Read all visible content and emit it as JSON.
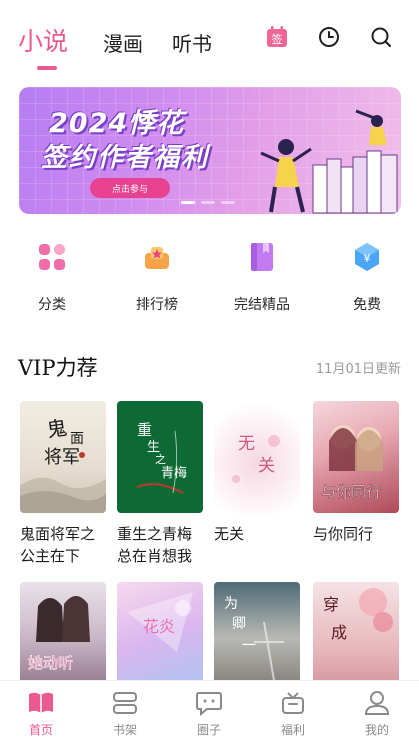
{
  "top_tabs": [
    {
      "label": "小说",
      "active": true
    },
    {
      "label": "漫画",
      "active": false
    },
    {
      "label": "听书",
      "active": false
    }
  ],
  "top_icons": {
    "sign_badge": "签",
    "clock": "clock-icon",
    "search": "search-icon"
  },
  "banner": {
    "title_line1": "2024悸花",
    "title_line2": "签约作者福利",
    "button_label": "点击参与",
    "slide_count": 3,
    "active_slide": 1
  },
  "categories": [
    {
      "label": "分类",
      "icon": "grid-icon",
      "color": "#f06ea8"
    },
    {
      "label": "排行榜",
      "icon": "trophy-icon",
      "color": "#f7a34a"
    },
    {
      "label": "完结精品",
      "icon": "book-icon",
      "color": "#c27af0"
    },
    {
      "label": "免费",
      "icon": "yen-hexagon-icon",
      "color": "#4aa6f5"
    }
  ],
  "vip": {
    "title": "VIP力荐",
    "update_text": "11月01日更新",
    "books": [
      {
        "title": "鬼面将军之公主在下",
        "cover_text": "鬼面将军"
      },
      {
        "title": "重生之青梅总在肖想我",
        "cover_text": "重生之青梅"
      },
      {
        "title": "无关",
        "cover_text": "无关"
      },
      {
        "title": "与你同行",
        "cover_text": "与你同行"
      },
      {
        "title": "",
        "cover_text": "她动听"
      },
      {
        "title": "",
        "cover_text": "花炎"
      },
      {
        "title": "",
        "cover_text": "为卿"
      },
      {
        "title": "",
        "cover_text": "穿成"
      }
    ]
  },
  "bottom_nav": [
    {
      "label": "首页",
      "icon": "home-book-icon",
      "active": true
    },
    {
      "label": "书架",
      "icon": "bookshelf-icon",
      "active": false
    },
    {
      "label": "圈子",
      "icon": "chat-bubble-icon",
      "active": false
    },
    {
      "label": "福利",
      "icon": "gift-icon",
      "active": false
    },
    {
      "label": "我的",
      "icon": "profile-icon",
      "active": false
    }
  ],
  "colors": {
    "accent": "#ea5a8e",
    "text": "#1d1d1d",
    "muted": "#9b9b9b"
  }
}
